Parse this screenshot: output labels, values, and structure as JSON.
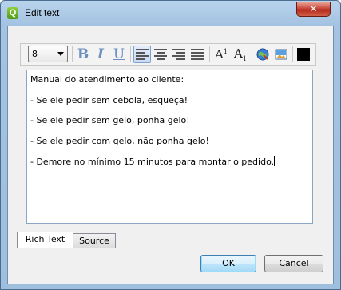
{
  "window": {
    "title": "Edit text",
    "app_icon_glyph": "Q",
    "close_glyph": "✕"
  },
  "toolbar": {
    "font_size": "8",
    "bold_glyph": "B",
    "italic_glyph": "I",
    "underline_glyph": "U",
    "superscript_glyph": "A",
    "superscript_mark": "1",
    "subscript_glyph": "A",
    "subscript_mark": "1",
    "color_swatch": "#000000",
    "accent": "#6a8fc0"
  },
  "editor": {
    "lines": [
      "Manual do atendimento ao cliente:",
      "- Se ele pedir sem cebola, esqueça!",
      "- Se ele pedir sem gelo, ponha gelo!",
      "- Se ele pedir com gelo, não ponha gelo!",
      "- Demore no mínimo 15 minutos para montar o pedido."
    ]
  },
  "tabs": [
    {
      "label": "Rich Text",
      "active": true
    },
    {
      "label": "Source",
      "active": false
    }
  ],
  "buttons": {
    "ok": "OK",
    "cancel": "Cancel"
  }
}
